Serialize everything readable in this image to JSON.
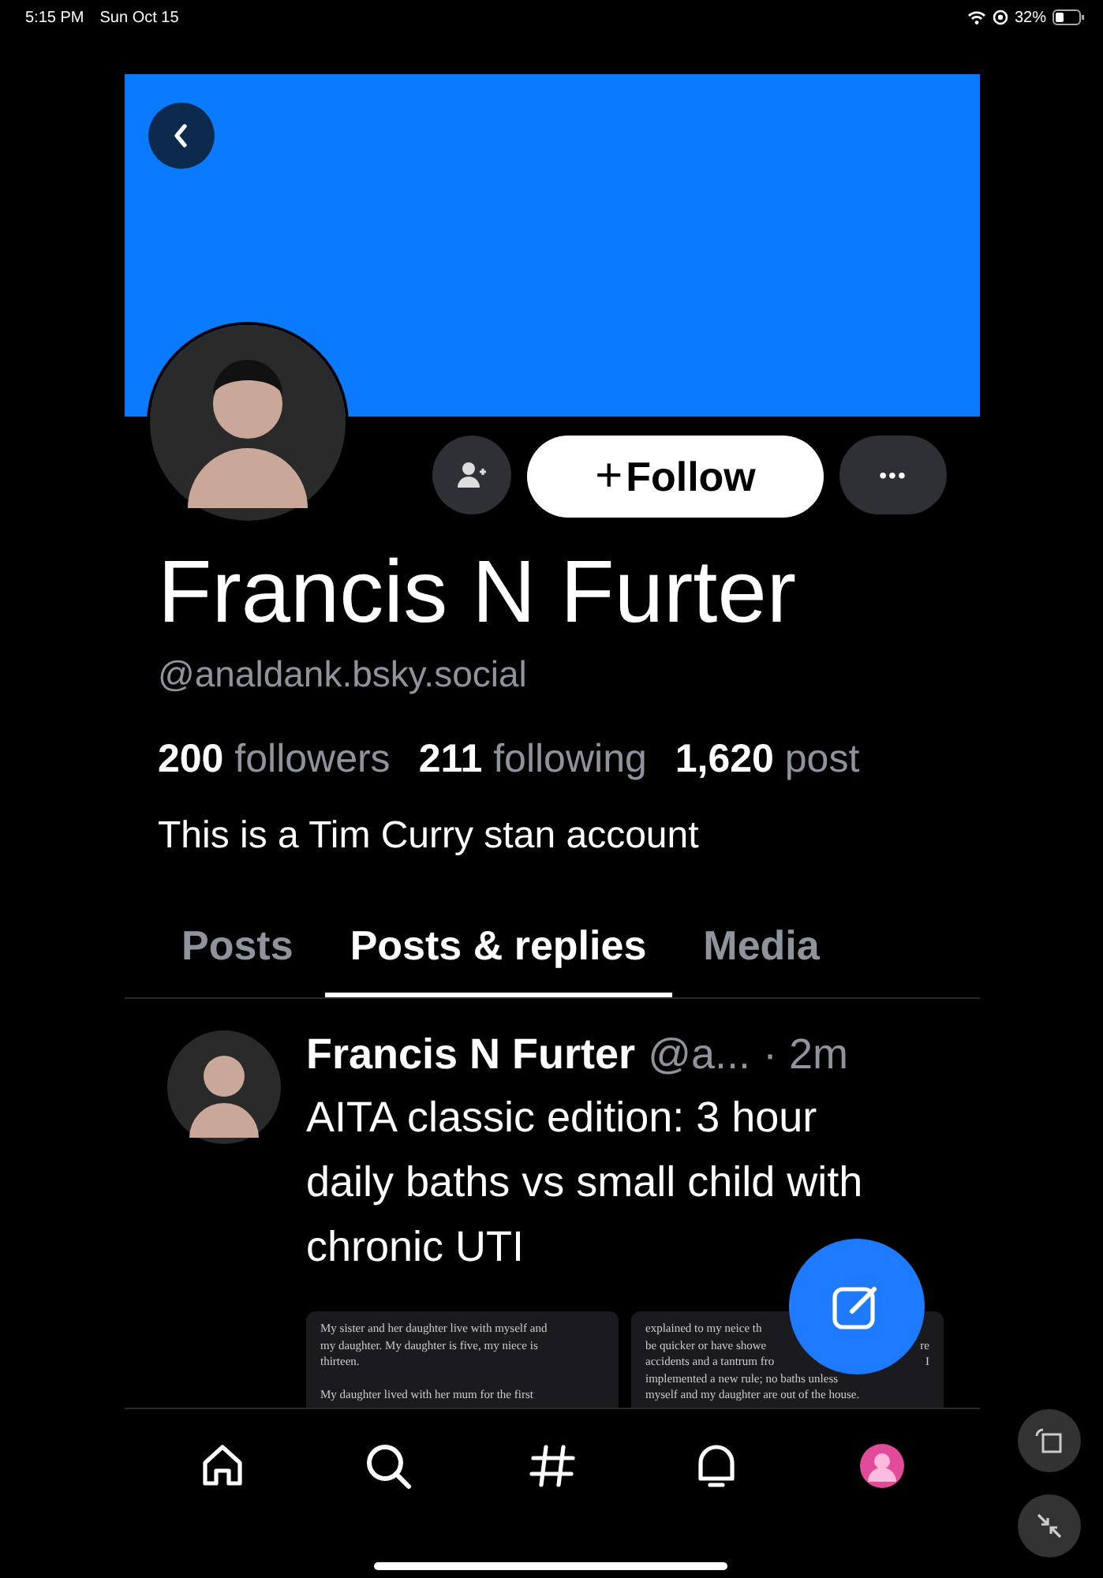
{
  "status_bar": {
    "time": "5:15 PM",
    "date": "Sun Oct 15",
    "battery": "32%"
  },
  "profile": {
    "name": "Francis N Furter",
    "handle": "@analdank.bsky.social",
    "follow_label": "Follow",
    "follow_glyph": "+",
    "more_glyph": "•••",
    "stats": [
      "**200** followers",
      "**211** following",
      "**1,620** post"
    ],
    "bio": "This is a Tim Curry stan account"
  },
  "tabs": [
    {
      "label": "Posts",
      "selected": false
    },
    {
      "label": "Posts & replies",
      "selected": true
    },
    {
      "label": "Media",
      "selected": false
    }
  ],
  "posts": [
    {
      "author": "Francis N Furter",
      "handle": "@a...",
      "time": "· 2m",
      "text": "AITA classic edition: 3 hour daily baths vs small child with chronic UTI",
      "images": [
        {
          "paragraphs": [
            [
              [
                "My sister and her daughter live with myself and"
              ],
              [
                "my daughter. My daughter is five, my niece is"
              ],
              [
                "thirteen."
              ]
            ],
            [
              [
                "My daughter lived with her mum for the first"
              ]
            ]
          ]
        },
        {
          "paragraphs": [
            [
              [
                "explained to my neice th"
              ],
              [
                "be quicker or have showe",
                "re"
              ],
              [
                "accidents and a tantrum fro",
                "I"
              ],
              [
                "implemented a new rule; no baths unless"
              ],
              [
                "myself and my daughter are out of the house."
              ]
            ]
          ]
        }
      ]
    }
  ],
  "nav": [
    {
      "kind": "home"
    },
    {
      "kind": "search"
    },
    {
      "kind": "feeds"
    },
    {
      "kind": "notifications"
    },
    {
      "kind": "profile"
    }
  ]
}
